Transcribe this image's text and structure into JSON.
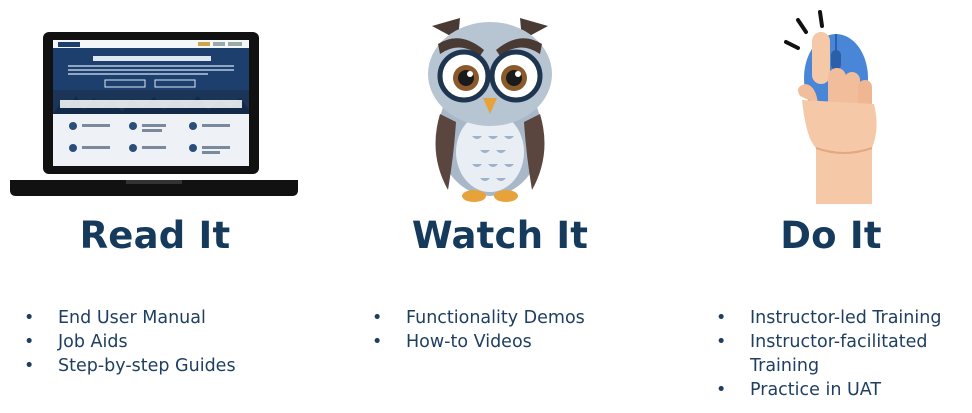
{
  "columns": [
    {
      "heading": "Read It",
      "illustration": "laptop-with-knowledge-center-website",
      "items": [
        "End User Manual",
        "Job Aids",
        "Step-by-step Guides"
      ]
    },
    {
      "heading": "Watch It",
      "illustration": "owl-with-glasses",
      "items": [
        "Functionality Demos",
        "How-to Videos"
      ]
    },
    {
      "heading": "Do It",
      "illustration": "hand-clicking-mouse",
      "items": [
        "Instructor-led Training",
        "Instructor-facilitated",
        "Training",
        "Practice in UAT"
      ]
    }
  ],
  "colors": {
    "heading": "#163a5c",
    "text": "#1f3f62",
    "laptop": "#111111",
    "website_header": "#1d3f6e",
    "mouse": "#4a86d8",
    "owl_body": "#a9b8c8"
  }
}
